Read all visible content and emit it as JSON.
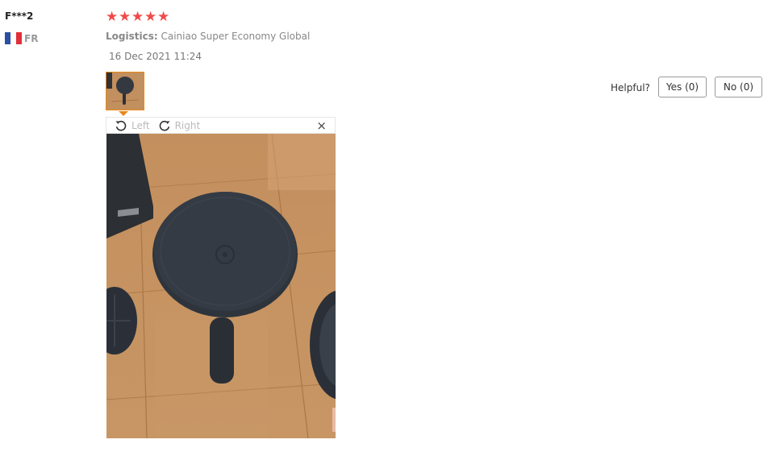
{
  "review": {
    "user_name": "F***2",
    "country_code": "FR",
    "rating": 5,
    "stars": [
      "★",
      "★",
      "★",
      "★",
      "★"
    ],
    "logistics_label": "Logistics:",
    "logistics_value": "Cainiao Super Economy Global",
    "date": "16 Dec 2021 11:24"
  },
  "helpful": {
    "label": "Helpful?",
    "yes": "Yes (0)",
    "no": "No (0)"
  },
  "viewer": {
    "rotate_left": "Left",
    "rotate_right": "Right",
    "close": "×"
  },
  "colors": {
    "star": "#f04b4b",
    "thumb_border": "#e8891a",
    "flag": [
      "#2b4fa3",
      "#ffffff",
      "#e0303a"
    ]
  }
}
